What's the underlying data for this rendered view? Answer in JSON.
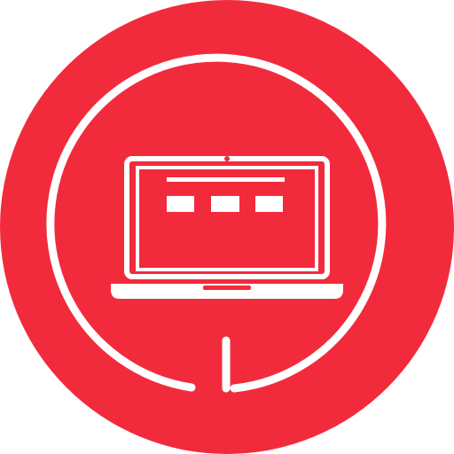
{
  "icon": {
    "name": "laptop-support-icon",
    "colors": {
      "background": "#f22b3c",
      "foreground": "#ffffff",
      "page": "#ffffff"
    }
  }
}
